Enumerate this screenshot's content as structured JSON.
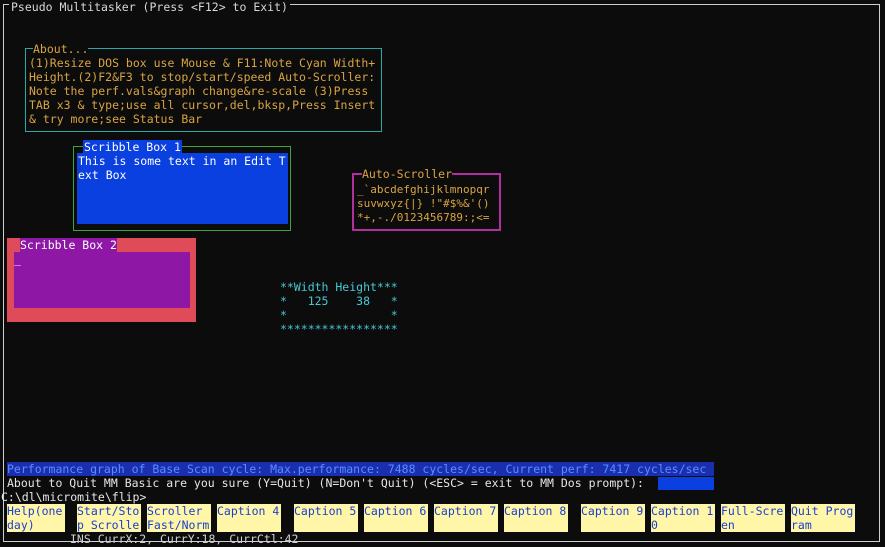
{
  "window": {
    "title": "Pseudo Multitasker (Press <F12> to Exit)"
  },
  "about": {
    "title": "About...",
    "text": "(1)Resize DOS box use Mouse & F11:Note Cyan Width+\nHeight.(2)F2&F3 to stop/start/speed Auto-Scroller:\nNote the perf.vals&graph change&re-scale (3)Press\nTAB x3 & type;use all cursor,del,bksp,Press Insert\n& try more;see Status Bar"
  },
  "scribble_box_1": {
    "title": "Scribble Box 1",
    "text": "This is some text in an Edit T\next Box"
  },
  "auto_scroller": {
    "title": "Auto-Scroller",
    "text": "_`abcdefghijklmnopqr\nsuvwxyz{|} !\"#$%&'()\n*+,-./0123456789:;<="
  },
  "scribble_box_2": {
    "title": "Scribble Box 2",
    "cursor": "_"
  },
  "dimensions": {
    "header": "**Width Height***",
    "row": "*   125    38   *",
    "blank": "*               *",
    "footer": "*****************"
  },
  "performance": {
    "text": "Performance graph of Base Scan cycle: Max.performance: 7488 cycles/sec, Current perf: 7417 cycles/sec"
  },
  "quit_prompt": {
    "text": "About to Quit MM Basic are you sure (Y=Quit) (N=Don't Quit) (<ESC> = exit to MM Dos prompt):"
  },
  "dos_prompt": {
    "text": "C:\\dl\\micromite\\flip>"
  },
  "function_keys": [
    {
      "label": "Help(one\nday)"
    },
    {
      "label": "Start/Sto\np Scrolle"
    },
    {
      "label": "Scroller\nFast/Norm"
    },
    {
      "label": "Caption 4"
    },
    {
      "label": "Caption 5"
    },
    {
      "label": "Caption 6"
    },
    {
      "label": "Caption 7"
    },
    {
      "label": "Caption 8"
    },
    {
      "label": "Caption 9"
    },
    {
      "label": "Caption 1\n0"
    },
    {
      "label": "Full-Scre\nen"
    },
    {
      "label": "Quit Prog\nram"
    }
  ],
  "status_bar": {
    "text": "INS CurrX:2, CurrY:18, CurrCtl:42"
  },
  "colors": {
    "background": "#0c0c0c",
    "about_text": "#d9a441",
    "about_border": "#2aa8a8",
    "scribble1_fill": "#0a3fe0",
    "scribble2_outer": "#e04b5a",
    "scribble2_inner": "#8e17a6",
    "auto_scroller_border": "#b0309e",
    "dimensions_text": "#47c8d4",
    "fkey_bg": "#fff6a8",
    "fkey_text": "#1a3fd0"
  }
}
